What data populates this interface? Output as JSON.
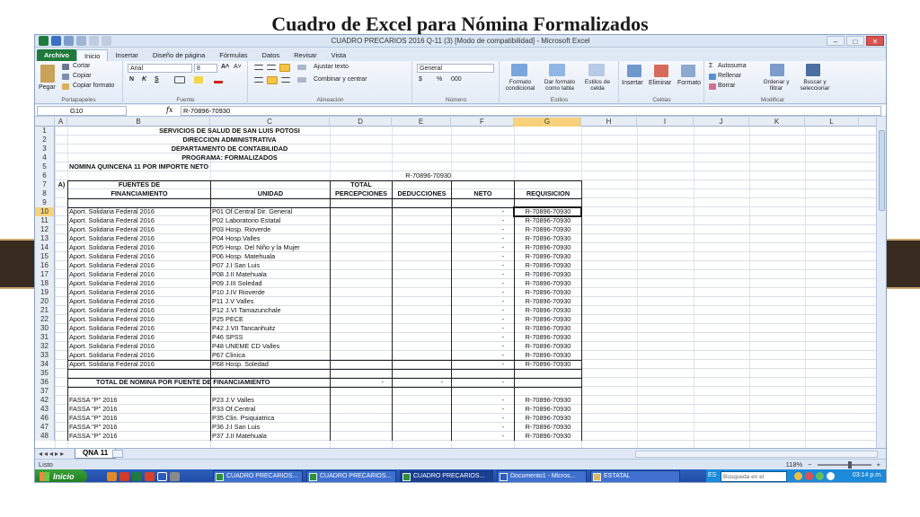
{
  "slide": {
    "title": "Cuadro de Excel para Nómina Formalizados"
  },
  "window": {
    "title": "CUADRO PRECARIOS 2016 Q-11 (3)  [Modo de compatibilidad]  -  Microsoft Excel",
    "controls": [
      "–",
      "□",
      "✕"
    ]
  },
  "ribbon": {
    "tabs": [
      "Archivo",
      "Inicio",
      "Insertar",
      "Diseño de página",
      "Fórmulas",
      "Datos",
      "Revisar",
      "Vista"
    ],
    "clipboard": {
      "paste": "Pegar",
      "cut": "Cortar",
      "copy": "Copiar",
      "format_painter": "Copiar formato",
      "group": "Portapapeles"
    },
    "font": {
      "name": "Arial",
      "size": "8",
      "bold": "N",
      "italic": "K",
      "underline": "S",
      "group": "Fuente"
    },
    "alignment": {
      "wrap": "Ajustar texto",
      "merge": "Combinar y centrar",
      "group": "Alineación"
    },
    "number": {
      "format": "General",
      "currency": "$",
      "percent": "%",
      "thousands": "000",
      "group": "Número"
    },
    "styles": {
      "conditional": "Formato condicional",
      "as_table": "Dar formato como tabla",
      "cell_styles": "Estilos de celda",
      "group": "Estilos"
    },
    "cells": {
      "insert": "Insertar",
      "delete": "Eliminar",
      "format": "Formato",
      "group": "Celdas"
    },
    "editing": {
      "autosum": "Autosuma",
      "fill": "Rellenar",
      "clear": "Borrar",
      "sort": "Ordenar y filtrar",
      "find": "Buscar y seleccionar",
      "group": "Modificar"
    }
  },
  "formula_bar": {
    "name_box": "G10",
    "fx": "fx",
    "content": "R-70896-70930"
  },
  "columns": [
    "A",
    "B",
    "C",
    "D",
    "E",
    "F",
    "G",
    "H",
    "I",
    "J",
    "K",
    "L"
  ],
  "sheet": {
    "rows": [
      {
        "n": "1",
        "c": "SERVICIOS DE SALUD DE SAN LUIS POTOSI"
      },
      {
        "n": "2",
        "c": "DIRECCION ADMINISTRATIVA"
      },
      {
        "n": "3",
        "c": "DEPARTAMENTO DE CONTABILIDAD"
      },
      {
        "n": "4",
        "c": "PROGRAMA:      FORMALIZADOS"
      },
      {
        "n": "5",
        "b": "NOMINA QUINCENA 11 POR IMPORTE NETO"
      },
      {
        "n": "6",
        "e": "R-70896-70930"
      },
      {
        "n": "7",
        "a": "A)",
        "b": "FUENTES DE",
        "d": "TOTAL"
      },
      {
        "n": "8",
        "b": "FINANCIAMIENTO",
        "c": "UNIDAD",
        "d": "PERCEPCIONES",
        "e": "DEDUCCIONES",
        "f": "NETO",
        "g": "REQUISICION"
      },
      {
        "n": "9"
      },
      {
        "n": "10",
        "b": "Aport. Solidaria Federal 2016",
        "c": "P01 Of.Central Dir. General",
        "f": "-",
        "g": "R-70896-70930"
      },
      {
        "n": "11",
        "b": "Aport. Solidaria Federal 2016",
        "c": "P02 Laboratorio Estatal",
        "f": "-",
        "g": "R-70896-70930"
      },
      {
        "n": "12",
        "b": "Aport. Solidaria Federal 2016",
        "c": "P03 Hosp. Rioverde",
        "f": "-",
        "g": "R-70896-70930"
      },
      {
        "n": "13",
        "b": "Aport. Solidaria Federal 2016",
        "c": "P04 Hosp.Valles",
        "f": "-",
        "g": "R-70896-70930"
      },
      {
        "n": "14",
        "b": "Aport. Solidaria Federal 2016",
        "c": "P05 Hosp. Del Niño y la Mujer",
        "f": "-",
        "g": "R-70896-70930"
      },
      {
        "n": "15",
        "b": "Aport. Solidaria Federal 2016",
        "c": "P06 Hosp. Matehuala",
        "f": "-",
        "g": "R-70896-70930"
      },
      {
        "n": "16",
        "b": "Aport. Solidaria Federal 2016",
        "c": "P07 J.I San Luis",
        "f": "-",
        "g": "R-70896-70930"
      },
      {
        "n": "17",
        "b": "Aport. Solidaria Federal 2016",
        "c": "P08 J.II Matehuala",
        "f": "-",
        "g": "R-70896-70930"
      },
      {
        "n": "18",
        "b": "Aport. Solidaria Federal 2016",
        "c": "P09 J.III Soledad",
        "f": "-",
        "g": "R-70896-70930"
      },
      {
        "n": "19",
        "b": "Aport. Solidaria Federal 2016",
        "c": "P10 J.IV Rioverde",
        "f": "-",
        "g": "R-70896-70930"
      },
      {
        "n": "20",
        "b": "Aport. Solidaria Federal 2016",
        "c": "P11 J.V Valles",
        "f": "-",
        "g": "R-70896-70930"
      },
      {
        "n": "21",
        "b": "Aport. Solidaria Federal 2016",
        "c": "P12 J.VI Tamazunchale",
        "f": "-",
        "g": "R-70896-70930"
      },
      {
        "n": "22",
        "b": "Aport. Solidaria Federal 2016",
        "c": "P25 PECE",
        "f": "-",
        "g": "R-70896-70930"
      },
      {
        "n": "30",
        "b": "Aport. Solidaria Federal 2016",
        "c": "P42 J.VII Tancanhuitz",
        "f": "-",
        "g": "R-70896-70930"
      },
      {
        "n": "31",
        "b": "Aport. Solidaria Federal 2016",
        "c": "P46 SPSS",
        "f": "-",
        "g": "R-70896-70930"
      },
      {
        "n": "32",
        "b": "Aport. Solidaria Federal 2016",
        "c": "P48 UNEME CD Valles",
        "f": "-",
        "g": "R-70896-70930"
      },
      {
        "n": "33",
        "b": "Aport. Solidaria Federal 2016",
        "c": "P67 Clinica",
        "f": "-",
        "g": "R-70896-70930"
      },
      {
        "n": "34",
        "b": "Aport. Solidaria Federal 2016",
        "c": "P68 Hosp. Soledad",
        "f": "-",
        "g": "R-70896-70930"
      },
      {
        "n": "35"
      },
      {
        "n": "36",
        "b": "TOTAL DE NOMINA POR FUENTE DE FINANCIAMIENTO",
        "d": "-",
        "e": "-",
        "f": "-"
      },
      {
        "n": "37"
      },
      {
        "n": "42",
        "b": "FASSA \"P\" 2016",
        "c": "P23 J.V Valles",
        "f": "-",
        "g": "R-70896-70930"
      },
      {
        "n": "43",
        "b": "FASSA \"P\" 2016",
        "c": "P33 Of.Central",
        "f": "-",
        "g": "R-70896-70930"
      },
      {
        "n": "46",
        "b": "FASSA \"P\" 2016",
        "c": "P35 Clin. Psiquiatrica",
        "f": "-",
        "g": "R-70896-70930"
      },
      {
        "n": "47",
        "b": "FASSA \"P\" 2016",
        "c": "P36 J.I San Luis",
        "f": "-",
        "g": "R-70896-70930"
      },
      {
        "n": "48",
        "b": "FASSA \"P\" 2016",
        "c": "P37 J.II Matehuala",
        "f": "-",
        "g": "R-70896-70930"
      }
    ]
  },
  "sheet_tab": "QNA 11",
  "status": {
    "left": "Listo",
    "zoom": "118%"
  },
  "taskbar": {
    "start": "Inicio",
    "items": [
      "CUADRO PRECARIOS...",
      "CUADRO PRECARIOS...",
      "CUADRO PRECARIOS...",
      "Documento1 - Micros...",
      "ESTATAL"
    ],
    "lang": "ES",
    "search_placeholder": "Búsqueda en el escritorio",
    "clock": "03:14 p.m."
  },
  "colors": {
    "band": "#3a2b20",
    "accent_gold": "#c9a96e",
    "file_tab": "#1f7a3c",
    "selected_header": "#f7d27a"
  }
}
